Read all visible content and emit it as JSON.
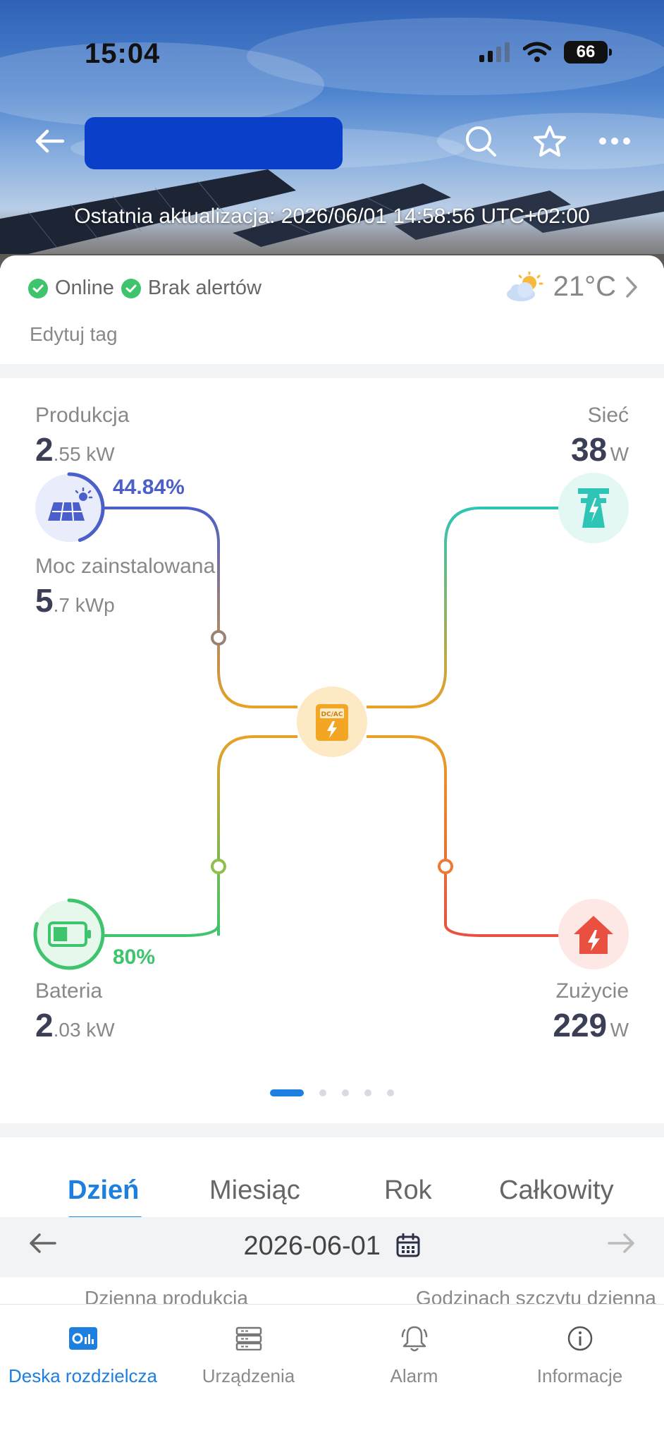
{
  "status_bar": {
    "time": "15:04",
    "battery": "66"
  },
  "header": {
    "title": "",
    "last_update": "Ostatnia aktualizacja: 2026/06/01 14:58:56 UTC+02:00"
  },
  "status": {
    "online": "Online",
    "alerts": "Brak alertów",
    "temperature": "21°C",
    "edit_tag": "Edytuj tag"
  },
  "flow": {
    "production": {
      "label": "Produkcja",
      "value_int": "2",
      "value_dec": ".55 kW",
      "percent": "44.84%"
    },
    "installed": {
      "label": "Moc zainstalowana",
      "value_int": "5",
      "value_dec": ".7 kWp"
    },
    "grid": {
      "label": "Sieć",
      "value": "38",
      "unit": "W"
    },
    "battery": {
      "label": "Bateria",
      "value_int": "2",
      "value_dec": ".03 kW",
      "percent": "80%",
      "soc_fraction": 0.8
    },
    "consumption": {
      "label": "Zużycie",
      "value": "229",
      "unit": "W"
    },
    "inverter_label": "DC/AC",
    "production_fraction": 0.4484
  },
  "pager": {
    "count": 5,
    "active": 0
  },
  "tabs": [
    "Dzień",
    "Miesiąc",
    "Rok",
    "Całkowity"
  ],
  "active_tab": "Dzień",
  "date": "2026-06-01",
  "sub_labels": {
    "left": "Dzienna produkcja",
    "right": "Godzinach szczytu dzienna"
  },
  "bottom_nav": [
    {
      "label": "Deska rozdzielcza",
      "icon": "dashboard-icon",
      "active": true
    },
    {
      "label": "Urządzenia",
      "icon": "devices-icon",
      "active": false
    },
    {
      "label": "Alarm",
      "icon": "bell-icon",
      "active": false
    },
    {
      "label": "Informacje",
      "icon": "info-icon",
      "active": false
    }
  ],
  "colors": {
    "accent": "#1d7fe0",
    "production": "#4a5fc9",
    "grid": "#2ec4b6",
    "battery": "#3ec46d",
    "consumption": "#e9503f",
    "inverter": "#f2a623"
  }
}
